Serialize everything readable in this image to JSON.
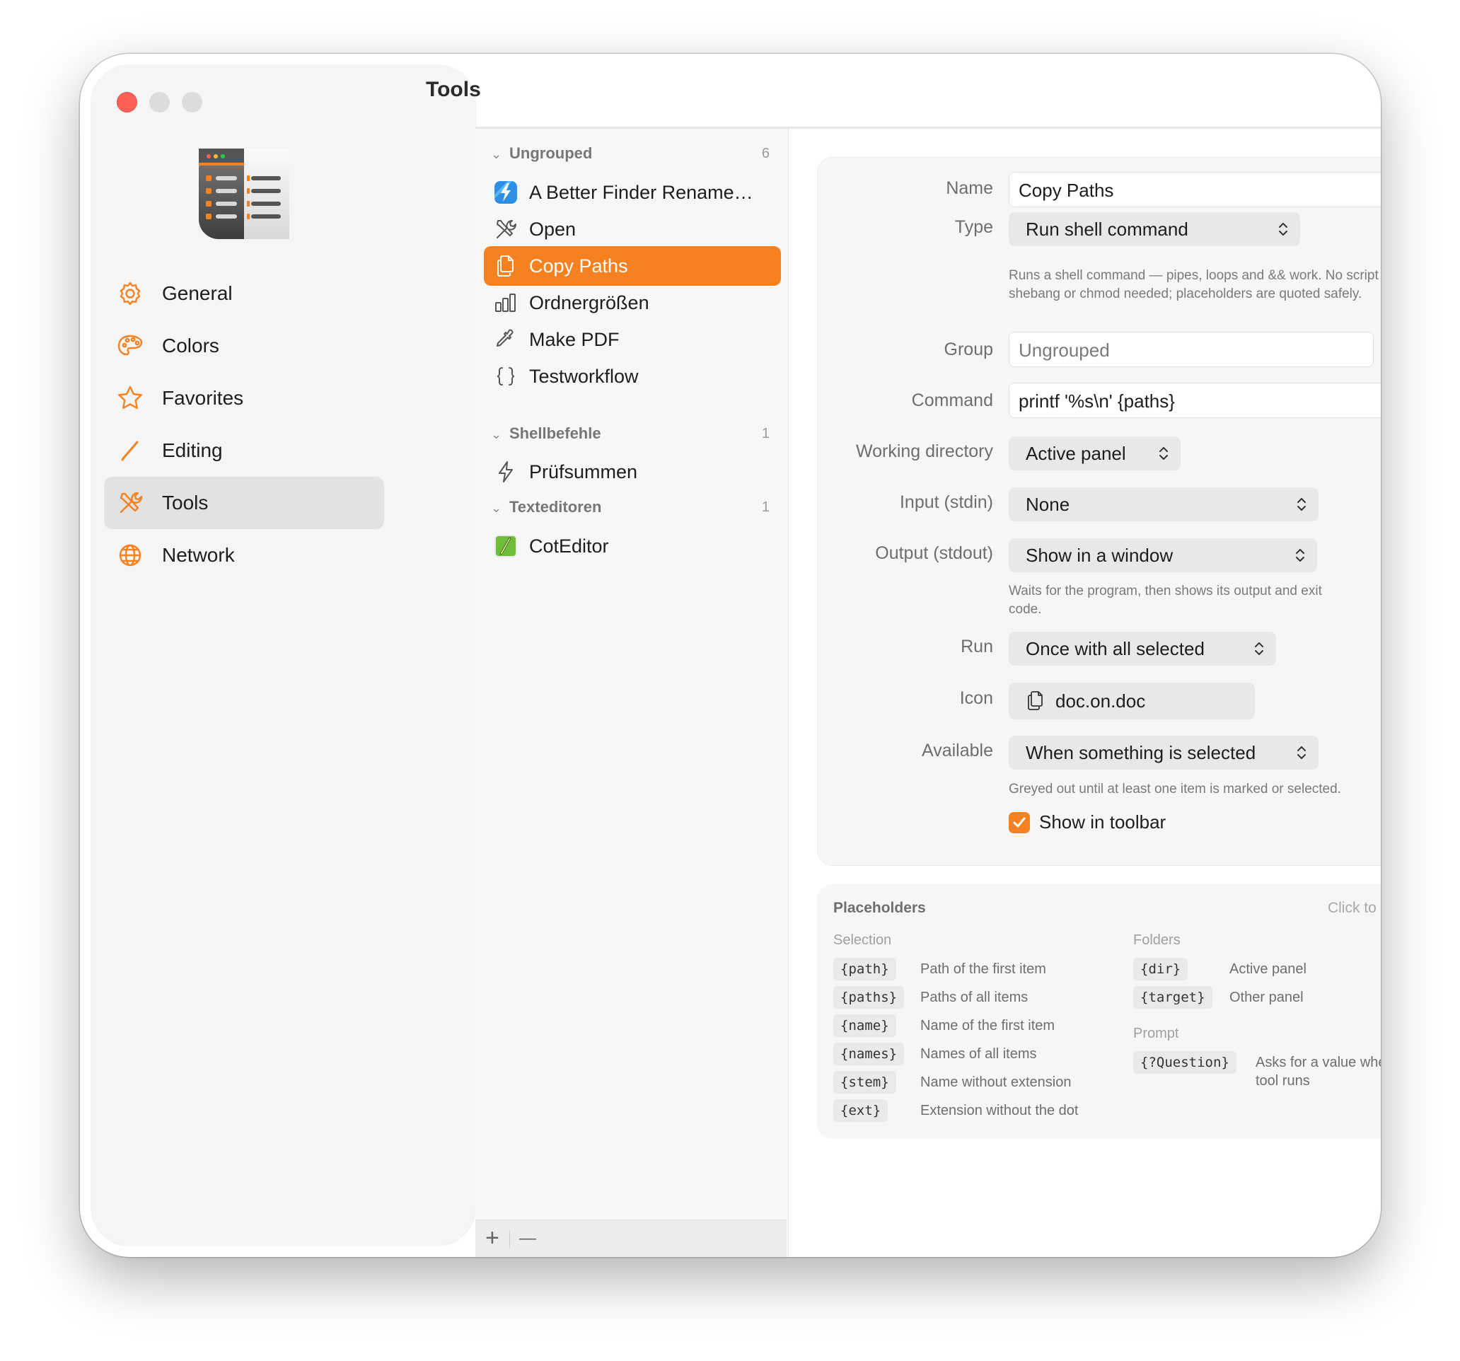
{
  "window": {
    "title": "Tools"
  },
  "sidebar": {
    "items": [
      {
        "label": "General",
        "icon": "gear-icon",
        "selected": false
      },
      {
        "label": "Colors",
        "icon": "palette-icon",
        "selected": false
      },
      {
        "label": "Favorites",
        "icon": "star-icon",
        "selected": false
      },
      {
        "label": "Editing",
        "icon": "pencil-icon",
        "selected": false
      },
      {
        "label": "Tools",
        "icon": "wrench-screwdriver-icon",
        "selected": true
      },
      {
        "label": "Network",
        "icon": "globe-icon",
        "selected": false
      }
    ]
  },
  "tools_list": {
    "groups": [
      {
        "name": "Ungrouped",
        "count": "6",
        "items": [
          {
            "label": "A Better Finder Rename…",
            "icon": "abfr-app-icon",
            "selected": false
          },
          {
            "label": "Open",
            "icon": "wrench-screwdriver-icon",
            "selected": false
          },
          {
            "label": "Copy Paths",
            "icon": "doc-on-doc-icon",
            "selected": true
          },
          {
            "label": "Ordnergrößen",
            "icon": "bar-chart-icon",
            "selected": false
          },
          {
            "label": "Make PDF",
            "icon": "eyedropper-icon",
            "selected": false
          },
          {
            "label": "Testworkflow",
            "icon": "curly-braces-icon",
            "selected": false
          }
        ]
      },
      {
        "name": "Shellbefehle",
        "count": "1",
        "items": [
          {
            "label": "Prüfsummen",
            "icon": "bolt-icon",
            "selected": false
          }
        ]
      },
      {
        "name": "Texteditoren",
        "count": "1",
        "items": [
          {
            "label": "CotEditor",
            "icon": "coteditor-app-icon",
            "selected": false
          }
        ]
      }
    ],
    "footer": {
      "add": "+",
      "remove": "—"
    }
  },
  "detail": {
    "name": {
      "label": "Name",
      "value": "Copy Paths"
    },
    "type": {
      "label": "Type",
      "value": "Run shell command",
      "hint": "Runs a shell command — pipes, loops and && work. No script file, shebang or chmod needed; placeholders are quoted safely."
    },
    "group": {
      "label": "Group",
      "placeholder": "Ungrouped"
    },
    "command": {
      "label": "Command",
      "value": "printf '%s\\n' {paths}"
    },
    "working_directory": {
      "label": "Working directory",
      "value": "Active panel"
    },
    "input": {
      "label": "Input (stdin)",
      "value": "None"
    },
    "output": {
      "label": "Output (stdout)",
      "value": "Show in a window",
      "hint": "Waits for the program, then shows its output and exit code."
    },
    "run": {
      "label": "Run",
      "value": "Once with all selected"
    },
    "icon": {
      "label": "Icon",
      "value": "doc.on.doc"
    },
    "available": {
      "label": "Available",
      "value": "When something is selected",
      "hint": "Greyed out until at least one item is marked or selected."
    },
    "show_in_toolbar": {
      "label": "Show in toolbar",
      "checked": true
    }
  },
  "placeholders": {
    "title": "Placeholders",
    "hint": "Click to insert",
    "selection": {
      "title": "Selection",
      "items": [
        {
          "token": "{path}",
          "desc": "Path of the first item"
        },
        {
          "token": "{paths}",
          "desc": "Paths of all items"
        },
        {
          "token": "{name}",
          "desc": "Name of the first item"
        },
        {
          "token": "{names}",
          "desc": "Names of all items"
        },
        {
          "token": "{stem}",
          "desc": "Name without extension"
        },
        {
          "token": "{ext}",
          "desc": "Extension without the dot"
        }
      ]
    },
    "folders": {
      "title": "Folders",
      "items": [
        {
          "token": "{dir}",
          "desc": "Active panel"
        },
        {
          "token": "{target}",
          "desc": "Other panel"
        }
      ]
    },
    "prompt": {
      "title": "Prompt",
      "items": [
        {
          "token": "{?Question}",
          "desc": "Asks for a value when the tool runs"
        }
      ]
    }
  },
  "colors": {
    "accent": "#f58121",
    "close": "#fe5f57"
  }
}
